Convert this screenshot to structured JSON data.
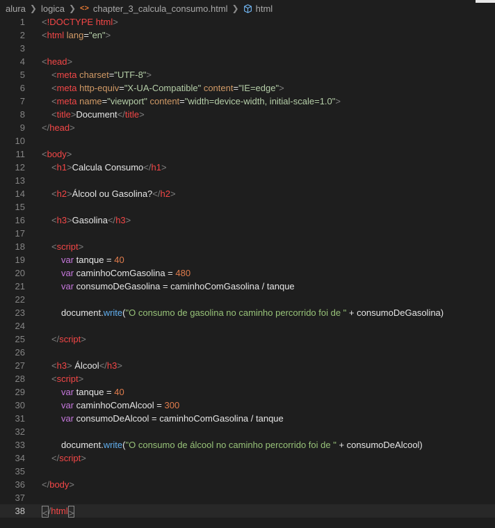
{
  "breadcrumb": {
    "items": [
      "alura",
      "logica",
      "chapter_3_calcula_consumo.html",
      "html"
    ]
  },
  "colors": {
    "background": "#1e1e1e",
    "tag": "#f44747",
    "string": "#98c379",
    "number": "#e07c4c",
    "keyword": "#c678dd",
    "function": "#61afef"
  },
  "editor": {
    "active_line": 38,
    "lines": [
      {
        "n": "1",
        "indent": 0,
        "tokens": [
          [
            "br",
            "<"
          ],
          [
            "tag",
            "!DOCTYPE"
          ],
          [
            "txt",
            " "
          ],
          [
            "tag",
            "html"
          ],
          [
            "br",
            ">"
          ]
        ]
      },
      {
        "n": "2",
        "indent": 0,
        "tokens": [
          [
            "br",
            "<"
          ],
          [
            "tag",
            "html"
          ],
          [
            "txt",
            " "
          ],
          [
            "attrname",
            "lang"
          ],
          [
            "txt",
            "="
          ],
          [
            "str",
            "\"en\""
          ],
          [
            "br",
            ">"
          ]
        ]
      },
      {
        "n": "3",
        "indent": 0,
        "tokens": []
      },
      {
        "n": "4",
        "indent": 0,
        "tokens": [
          [
            "br",
            "<"
          ],
          [
            "tag",
            "head"
          ],
          [
            "br",
            ">"
          ]
        ]
      },
      {
        "n": "5",
        "indent": 1,
        "tokens": [
          [
            "br",
            "<"
          ],
          [
            "tag",
            "meta"
          ],
          [
            "txt",
            " "
          ],
          [
            "attrname",
            "charset"
          ],
          [
            "txt",
            "="
          ],
          [
            "str",
            "\"UTF-8\""
          ],
          [
            "br",
            ">"
          ]
        ]
      },
      {
        "n": "6",
        "indent": 1,
        "tokens": [
          [
            "br",
            "<"
          ],
          [
            "tag",
            "meta"
          ],
          [
            "txt",
            " "
          ],
          [
            "attrname",
            "http-equiv"
          ],
          [
            "txt",
            "="
          ],
          [
            "str",
            "\"X-UA-Compatible\""
          ],
          [
            "txt",
            " "
          ],
          [
            "attrname",
            "content"
          ],
          [
            "txt",
            "="
          ],
          [
            "str",
            "\"IE=edge\""
          ],
          [
            "br",
            ">"
          ]
        ]
      },
      {
        "n": "7",
        "indent": 1,
        "tokens": [
          [
            "br",
            "<"
          ],
          [
            "tag",
            "meta"
          ],
          [
            "txt",
            " "
          ],
          [
            "attrname",
            "name"
          ],
          [
            "txt",
            "="
          ],
          [
            "str",
            "\"viewport\""
          ],
          [
            "txt",
            " "
          ],
          [
            "attrname",
            "content"
          ],
          [
            "txt",
            "="
          ],
          [
            "str",
            "\"width=device-width, initial-scale=1.0\""
          ],
          [
            "br",
            ">"
          ]
        ]
      },
      {
        "n": "8",
        "indent": 1,
        "tokens": [
          [
            "br",
            "<"
          ],
          [
            "tag",
            "title"
          ],
          [
            "br",
            ">"
          ],
          [
            "txt",
            "Document"
          ],
          [
            "br",
            "</"
          ],
          [
            "tag",
            "title"
          ],
          [
            "br",
            ">"
          ]
        ]
      },
      {
        "n": "9",
        "indent": 0,
        "tokens": [
          [
            "br",
            "</"
          ],
          [
            "tag",
            "head"
          ],
          [
            "br",
            ">"
          ]
        ]
      },
      {
        "n": "10",
        "indent": 0,
        "tokens": []
      },
      {
        "n": "11",
        "indent": 0,
        "tokens": [
          [
            "br",
            "<"
          ],
          [
            "tag",
            "body"
          ],
          [
            "br",
            ">"
          ]
        ]
      },
      {
        "n": "12",
        "indent": 1,
        "tokens": [
          [
            "br",
            "<"
          ],
          [
            "tag",
            "h1"
          ],
          [
            "br",
            ">"
          ],
          [
            "txt",
            "Calcula Consumo"
          ],
          [
            "br",
            "</"
          ],
          [
            "tag",
            "h1"
          ],
          [
            "br",
            ">"
          ]
        ]
      },
      {
        "n": "13",
        "indent": 0,
        "tokens": []
      },
      {
        "n": "14",
        "indent": 1,
        "tokens": [
          [
            "br",
            "<"
          ],
          [
            "tag",
            "h2"
          ],
          [
            "br",
            ">"
          ],
          [
            "txt",
            "Álcool ou Gasolina?"
          ],
          [
            "br",
            "</"
          ],
          [
            "tag",
            "h2"
          ],
          [
            "br",
            ">"
          ]
        ]
      },
      {
        "n": "15",
        "indent": 0,
        "tokens": []
      },
      {
        "n": "16",
        "indent": 1,
        "tokens": [
          [
            "br",
            "<"
          ],
          [
            "tag",
            "h3"
          ],
          [
            "br",
            ">"
          ],
          [
            "txt",
            "Gasolina"
          ],
          [
            "br",
            "</"
          ],
          [
            "tag",
            "h3"
          ],
          [
            "br",
            ">"
          ]
        ]
      },
      {
        "n": "17",
        "indent": 0,
        "tokens": []
      },
      {
        "n": "18",
        "indent": 1,
        "tokens": [
          [
            "br",
            "<"
          ],
          [
            "tag",
            "script"
          ],
          [
            "br",
            ">"
          ]
        ]
      },
      {
        "n": "19",
        "indent": 2,
        "tokens": [
          [
            "kw",
            "var"
          ],
          [
            "txt",
            " tanque = "
          ],
          [
            "num",
            "40"
          ]
        ]
      },
      {
        "n": "20",
        "indent": 2,
        "tokens": [
          [
            "kw",
            "var"
          ],
          [
            "txt",
            " caminhoComGasolina = "
          ],
          [
            "num",
            "480"
          ]
        ]
      },
      {
        "n": "21",
        "indent": 2,
        "tokens": [
          [
            "kw",
            "var"
          ],
          [
            "txt",
            " consumoDeGasolina = caminhoComGasolina / tanque"
          ]
        ]
      },
      {
        "n": "22",
        "indent": 0,
        "tokens": []
      },
      {
        "n": "23",
        "indent": 2,
        "tokens": [
          [
            "txt",
            "document."
          ],
          [
            "fn",
            "write"
          ],
          [
            "txt",
            "("
          ],
          [
            "s",
            "\"O consumo de gasolina no caminho percorrido foi de \""
          ],
          [
            "txt",
            " + consumoDeGasolina)"
          ]
        ]
      },
      {
        "n": "24",
        "indent": 0,
        "tokens": []
      },
      {
        "n": "25",
        "indent": 1,
        "tokens": [
          [
            "br",
            "</"
          ],
          [
            "tag",
            "script"
          ],
          [
            "br",
            ">"
          ]
        ]
      },
      {
        "n": "26",
        "indent": 0,
        "tokens": []
      },
      {
        "n": "27",
        "indent": 1,
        "tokens": [
          [
            "br",
            "<"
          ],
          [
            "tag",
            "h3"
          ],
          [
            "br",
            ">"
          ],
          [
            "txt",
            " Álcool"
          ],
          [
            "br",
            "</"
          ],
          [
            "tag",
            "h3"
          ],
          [
            "br",
            ">"
          ]
        ]
      },
      {
        "n": "28",
        "indent": 1,
        "tokens": [
          [
            "br",
            "<"
          ],
          [
            "tag",
            "script"
          ],
          [
            "br",
            ">"
          ]
        ]
      },
      {
        "n": "29",
        "indent": 2,
        "tokens": [
          [
            "kw",
            "var"
          ],
          [
            "txt",
            " tanque = "
          ],
          [
            "num",
            "40"
          ]
        ]
      },
      {
        "n": "30",
        "indent": 2,
        "tokens": [
          [
            "kw",
            "var"
          ],
          [
            "txt",
            " caminhoComAlcool = "
          ],
          [
            "num",
            "300"
          ]
        ]
      },
      {
        "n": "31",
        "indent": 2,
        "tokens": [
          [
            "kw",
            "var"
          ],
          [
            "txt",
            " consumoDeAlcool = caminhoComGasolina / tanque"
          ]
        ]
      },
      {
        "n": "32",
        "indent": 0,
        "tokens": []
      },
      {
        "n": "33",
        "indent": 2,
        "tokens": [
          [
            "txt",
            "document."
          ],
          [
            "fn",
            "write"
          ],
          [
            "txt",
            "("
          ],
          [
            "s",
            "\"O consumo de álcool no caminho percorrido foi de \""
          ],
          [
            "txt",
            " + consumoDeAlcool)"
          ]
        ]
      },
      {
        "n": "34",
        "indent": 1,
        "tokens": [
          [
            "br",
            "</"
          ],
          [
            "tag",
            "script"
          ],
          [
            "br",
            ">"
          ]
        ]
      },
      {
        "n": "35",
        "indent": 0,
        "tokens": []
      },
      {
        "n": "36",
        "indent": 0,
        "tokens": [
          [
            "br",
            "</"
          ],
          [
            "tag",
            "body"
          ],
          [
            "br",
            ">"
          ]
        ]
      },
      {
        "n": "37",
        "indent": 0,
        "tokens": []
      },
      {
        "n": "38",
        "indent": 0,
        "tokens": [
          [
            "brbox",
            "<"
          ],
          [
            "br",
            "/"
          ],
          [
            "tag",
            "html"
          ],
          [
            "brbox",
            ">"
          ]
        ]
      }
    ]
  }
}
